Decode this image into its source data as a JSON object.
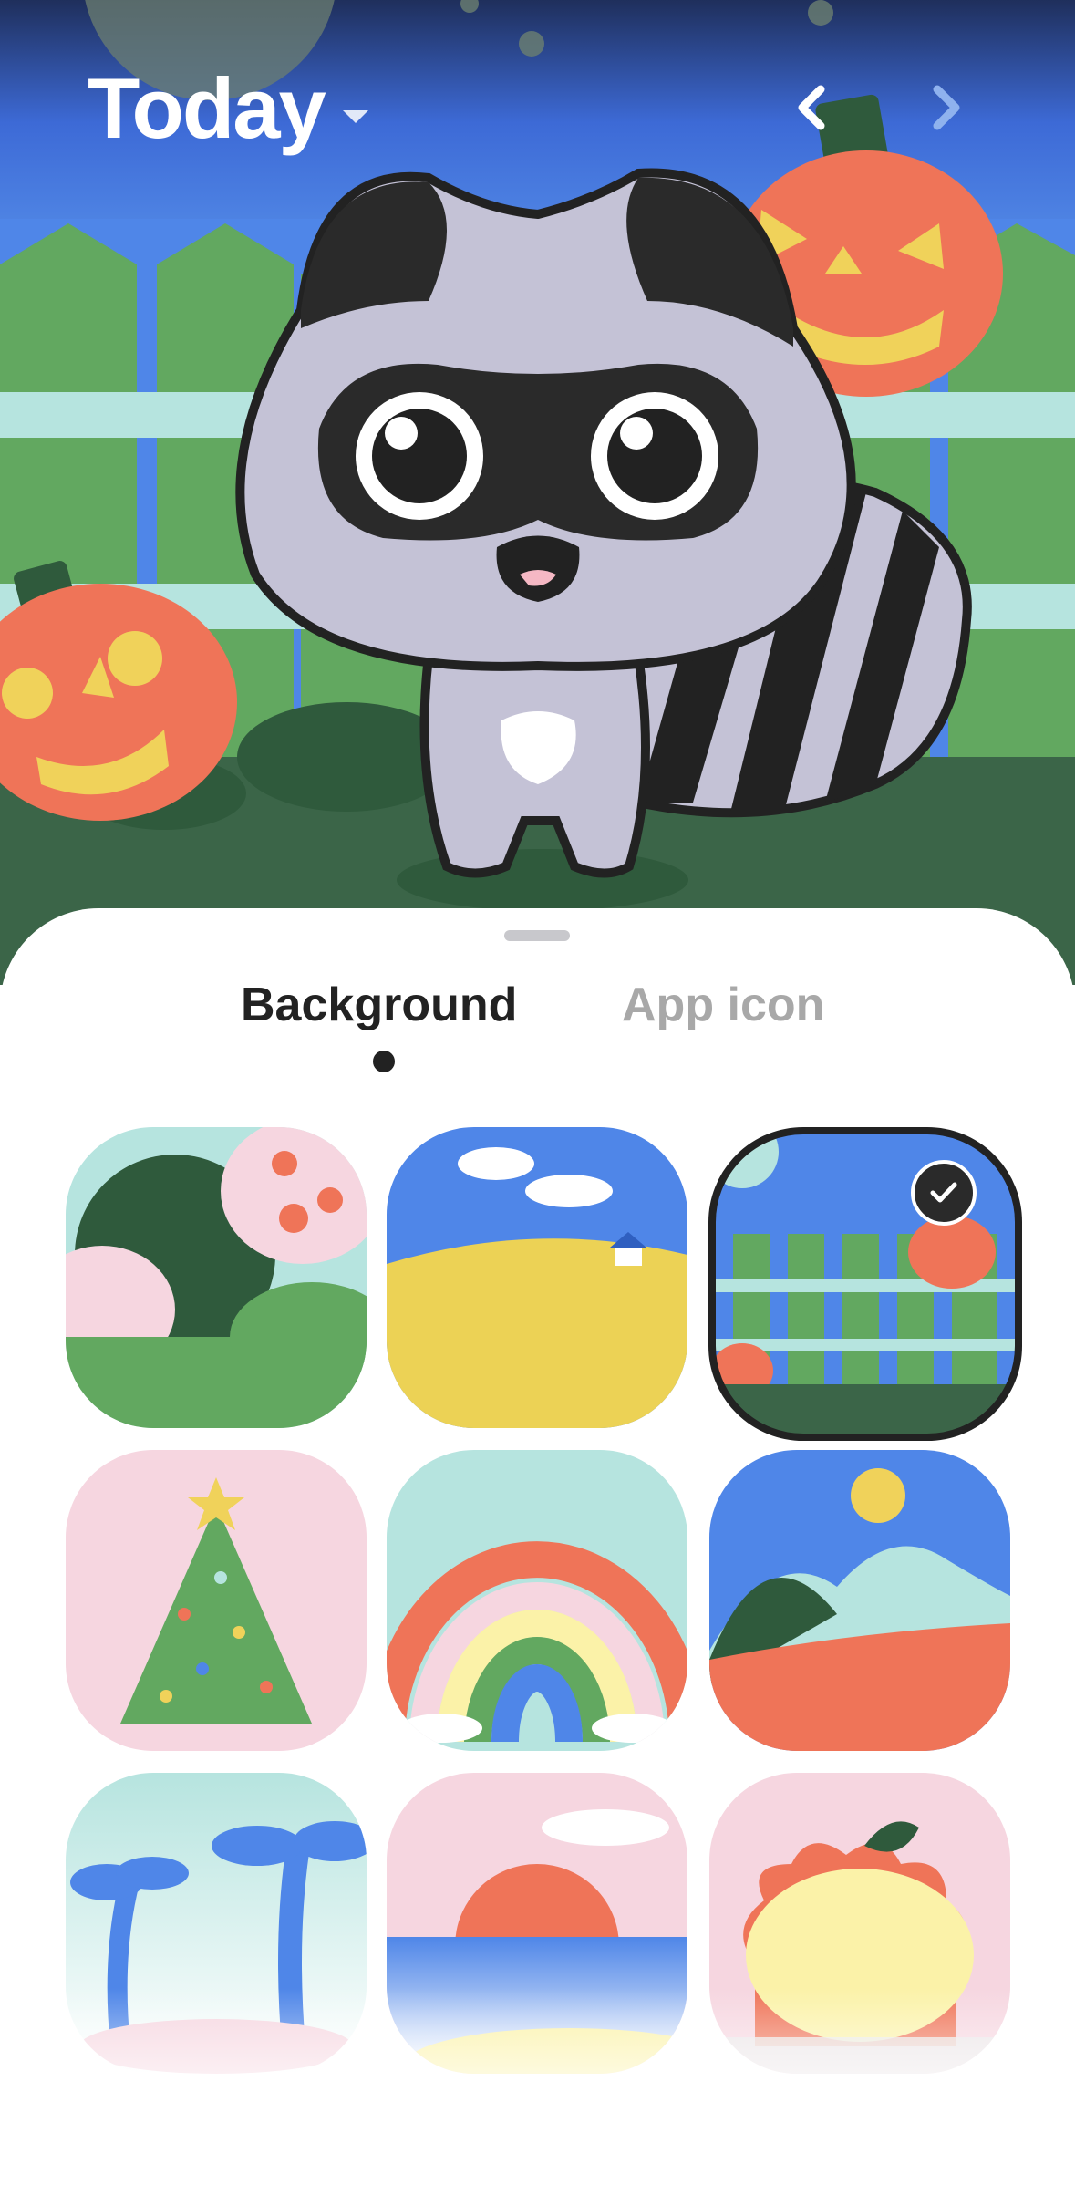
{
  "header": {
    "title": "Today",
    "title_dropdown_icon": "chevron-down-icon",
    "prev_icon": "chevron-left-icon",
    "next_icon": "chevron-right-icon"
  },
  "sheet": {
    "tabs": [
      {
        "label": "Background",
        "active": true
      },
      {
        "label": "App icon",
        "active": false
      }
    ]
  },
  "backgrounds": [
    {
      "theme": "garden-bushes",
      "selected": false
    },
    {
      "theme": "yellow-field",
      "selected": false
    },
    {
      "theme": "halloween-fence",
      "selected": true
    },
    {
      "theme": "christmas-tree",
      "selected": false
    },
    {
      "theme": "rainbow",
      "selected": false
    },
    {
      "theme": "mountains",
      "selected": false
    },
    {
      "theme": "palm-beach",
      "selected": false
    },
    {
      "theme": "sunset-ocean",
      "selected": false
    },
    {
      "theme": "flower-yellow",
      "selected": false
    }
  ],
  "colors": {
    "sky_blue": "#4f86e8",
    "fence_green": "#62a860",
    "pumpkin": "#ef7458",
    "accent_dark": "#222222",
    "inactive_tab": "#a8a8a8"
  }
}
